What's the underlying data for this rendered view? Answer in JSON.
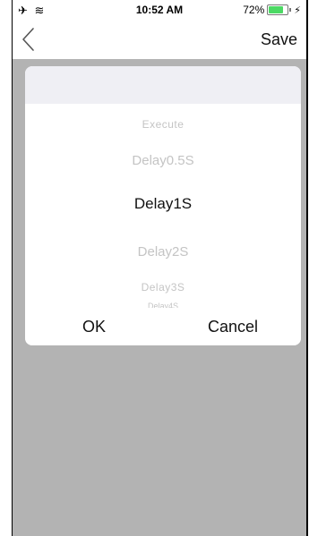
{
  "status_bar": {
    "left_icons": "✈ ≋",
    "time": "10:52 AM",
    "battery_percent": "72%",
    "battery_level": 0.72,
    "charging_icon": "⚡"
  },
  "nav": {
    "back_icon": "chevron-left-icon",
    "save_label": "Save"
  },
  "picker": {
    "options": [
      "Execute",
      "Delay0.5S",
      "Delay1S",
      "Delay2S",
      "Delay3S",
      "Delay4S"
    ],
    "selected": "Delay1S"
  },
  "dialog": {
    "ok_label": "OK",
    "cancel_label": "Cancel"
  },
  "colors": {
    "overlay": "#b3b3b3",
    "battery": "#4cd964",
    "dialog_header": "#efeff4"
  }
}
